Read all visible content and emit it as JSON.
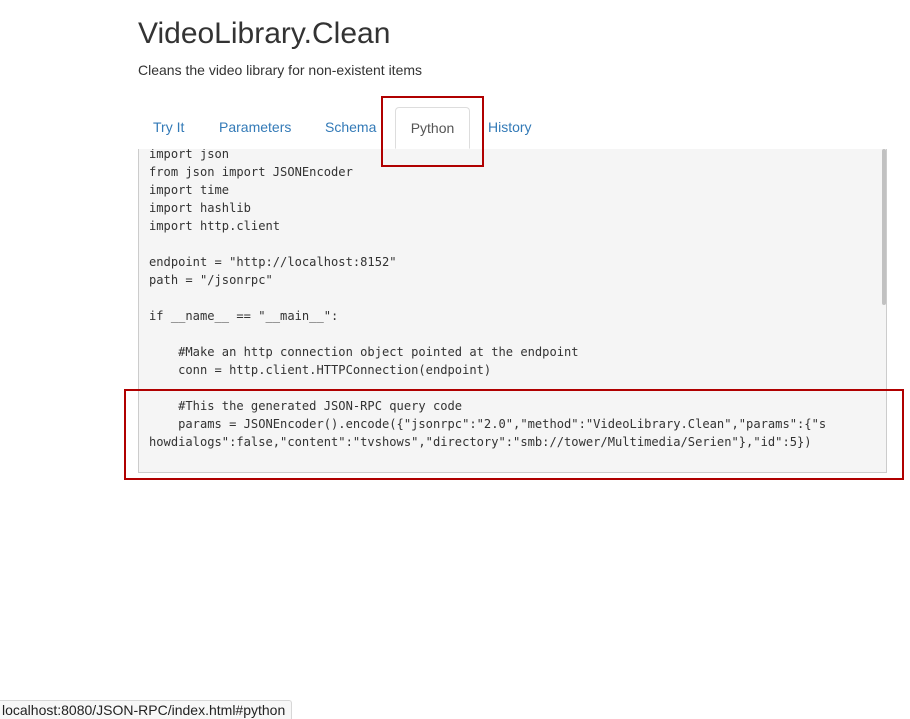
{
  "header": {
    "title": "VideoLibrary.Clean",
    "subtitle": "Cleans the video library for non-existent items"
  },
  "tabs": [
    {
      "label": "Try It",
      "active": false
    },
    {
      "label": "Parameters",
      "active": false
    },
    {
      "label": "Schema",
      "active": false
    },
    {
      "label": "Python",
      "active": true
    },
    {
      "label": "History",
      "active": false
    }
  ],
  "code": {
    "language": "python",
    "lines": [
      "import json",
      "from json import JSONEncoder",
      "import time",
      "import hashlib",
      "import http.client",
      "",
      "endpoint = \"http://localhost:8152\"",
      "path = \"/jsonrpc\"",
      "",
      "if __name__ == \"__main__\":",
      "",
      "    #Make an http connection object pointed at the endpoint",
      "    conn = http.client.HTTPConnection(endpoint)",
      "",
      "    #This the generated JSON-RPC query code",
      "    params = JSONEncoder().encode({\"jsonrpc\":\"2.0\",\"method\":\"VideoLibrary.Clean\",\"params\":{\"s",
      "howdialogs\":false,\"content\":\"tvshows\",\"directory\":\"smb://tower/Multimedia/Serien\"},\"id\":5})",
      "",
      "    #"
    ]
  },
  "status_bar": {
    "url": "localhost:8080/JSON-RPC/index.html#python"
  },
  "colors": {
    "link": "#337ab7",
    "highlight": "#b00000",
    "code_background": "#f5f5f5"
  }
}
